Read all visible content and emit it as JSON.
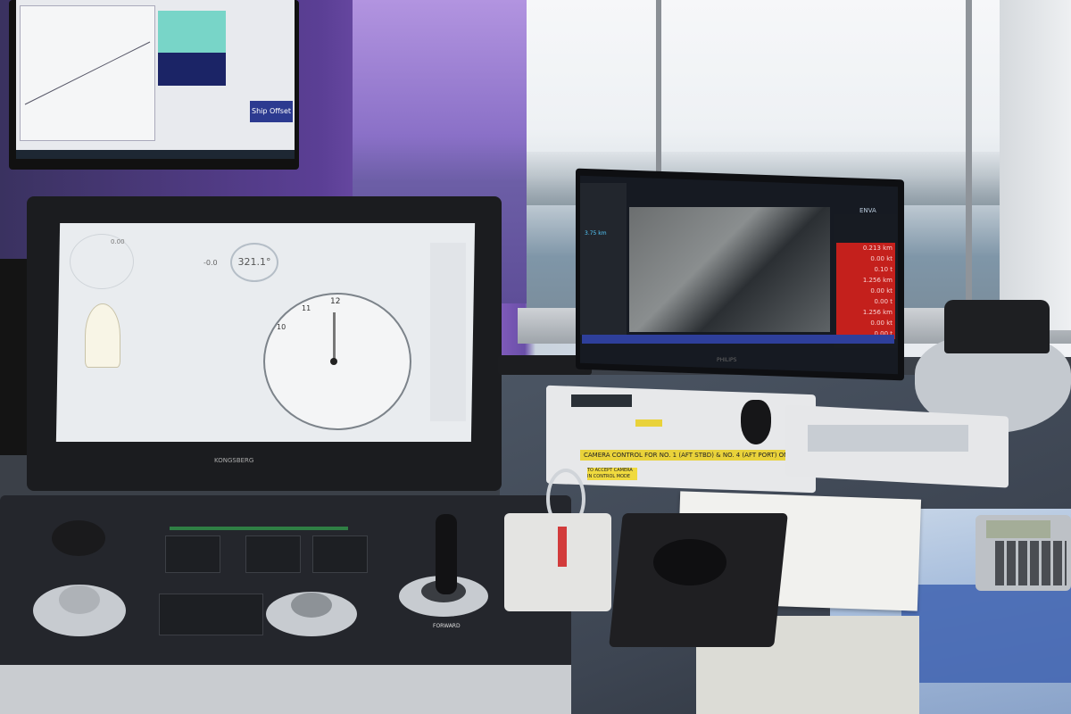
{
  "scene": {
    "colors": {
      "wall_purple": "#5b3f95",
      "sky": "#f1f3f6",
      "console": "#24262c",
      "radar_alert": "#c4201c",
      "label_yellow": "#e9d23a"
    }
  },
  "monitor_top": {
    "button_label": "Ship Offset"
  },
  "console_monitor": {
    "heading_value": "321.1°",
    "speed_value": "0.00",
    "rot_value": "-0.0",
    "dial_labels": [
      "12",
      "11",
      "10"
    ],
    "logo": "KONGSBERG"
  },
  "console": {
    "forward_label": "FORWARD"
  },
  "camera_controller": {
    "strip_text": "CAMERA CONTROL FOR NO. 1 (AFT STBD) & NO. 4 (AFT PORT) ONLY",
    "warning_text": "TO ACCEPT CAMERA IN CONTROL MODE"
  },
  "radar_monitor": {
    "brand": "ENVA",
    "distance_label": "3.75 km",
    "readings": [
      "0.213 km",
      "0.00 kt",
      "0.10 t",
      "1.256 km",
      "0.00 kt",
      "0.00 t",
      "1.256 km",
      "0.00 kt",
      "0.00 t"
    ],
    "logo": "PHILIPS"
  }
}
